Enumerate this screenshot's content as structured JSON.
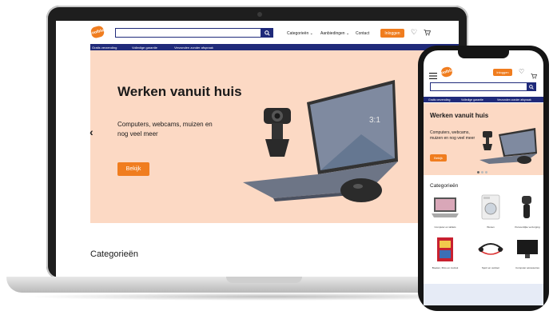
{
  "brand": {
    "logo_text": "Coolblue",
    "accent": "#f07d1f",
    "navy": "#1f2a7a",
    "hero_bg": "#fcd9c4"
  },
  "laptop": {
    "header": {
      "nav_categories": "Categorieën",
      "nav_offers": "Aanbiedingen",
      "nav_contact": "Contact",
      "login_label": "Inloggen",
      "icons": [
        "search-icon",
        "chevron-down-icon",
        "heart-icon",
        "cart-icon"
      ]
    },
    "usp_bar": [
      "Gratis verzending",
      "Volledige garantie",
      "Verzonden zonder afspraak"
    ],
    "hero": {
      "title": "Werken vanuit huis",
      "subtitle": "Computers, webcams, muizen en nog veel meer",
      "button_label": "Bekijk",
      "prev_arrow": "‹"
    },
    "categories_title": "Categorieën"
  },
  "phone": {
    "header": {
      "login_label": "Inloggen",
      "icons": [
        "menu-icon",
        "heart-icon",
        "cart-icon",
        "search-icon"
      ]
    },
    "usp_bar": [
      "Gratis verzending",
      "Volledige garantie",
      "Verzonden zonder afspraak"
    ],
    "hero": {
      "title": "Werken vanuit huis",
      "subtitle": "Computers, webcams, muizen en nog veel meer",
      "button_label": "Bekijk"
    },
    "categories_title": "Categorieën",
    "categories": [
      {
        "label": "Computer en tablets"
      },
      {
        "label": "Wonen"
      },
      {
        "label": "Persoonlijke verzorging"
      },
      {
        "label": "Boeken, films en muziek"
      },
      {
        "label": "Sport en outdoor"
      },
      {
        "label": "Computer accessoires"
      }
    ]
  }
}
